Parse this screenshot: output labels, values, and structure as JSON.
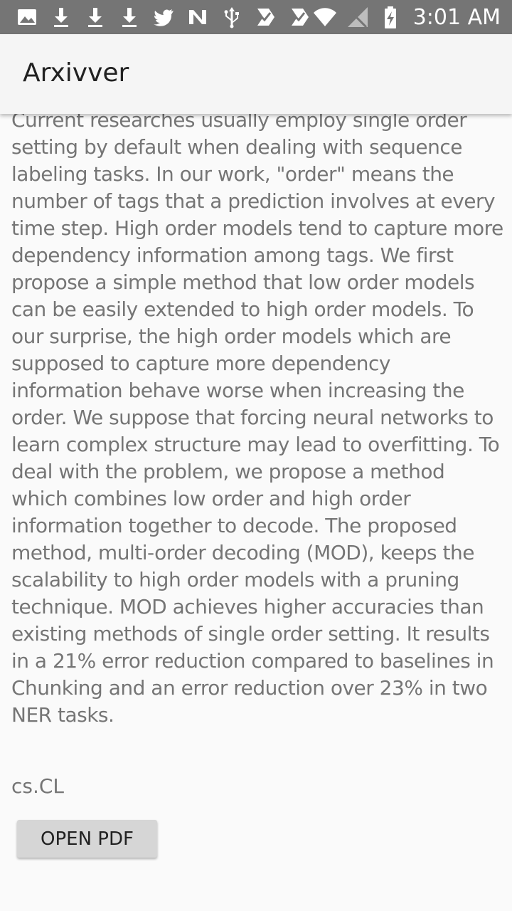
{
  "status_bar": {
    "time": "3:01 AM",
    "left_icons": [
      "image-icon",
      "download-icon",
      "download-icon",
      "download-icon",
      "twitter-icon",
      "n-app-icon",
      "usb-icon",
      "app-badge-icon",
      "app-badge-icon"
    ],
    "right_icons": [
      "wifi-icon",
      "no-signal-icon",
      "battery-charging-icon"
    ]
  },
  "app_bar": {
    "title": "Arxivver"
  },
  "main": {
    "abstract": "Current researches usually employ single order setting by default when dealing with sequence labeling tasks. In our work, \"order\" means the number of tags that a prediction involves at every time step. High order models tend to capture more dependency information among tags. We first propose a simple method that low order models can be easily extended to high order models. To our surprise, the high order models which are supposed to capture more dependency information behave worse when increasing the order. We suppose that forcing neural networks to learn complex structure may lead to overfitting. To deal with the problem, we propose a method which combines low order and high order information together to decode. The proposed method, multi-order decoding (MOD), keeps the scalability to high order models with a pruning technique. MOD achieves higher accuracies than existing methods of single order setting. It results in a 21% error reduction compared to baselines in Chunking and an error reduction over 23% in two NER tasks.",
    "category": "cs.CL",
    "open_pdf_label": "OPEN PDF"
  },
  "colors": {
    "status_bar_bg": "#757575",
    "app_bar_bg": "#f5f5f5",
    "body_text": "#757575",
    "button_bg": "#d6d6d6"
  }
}
